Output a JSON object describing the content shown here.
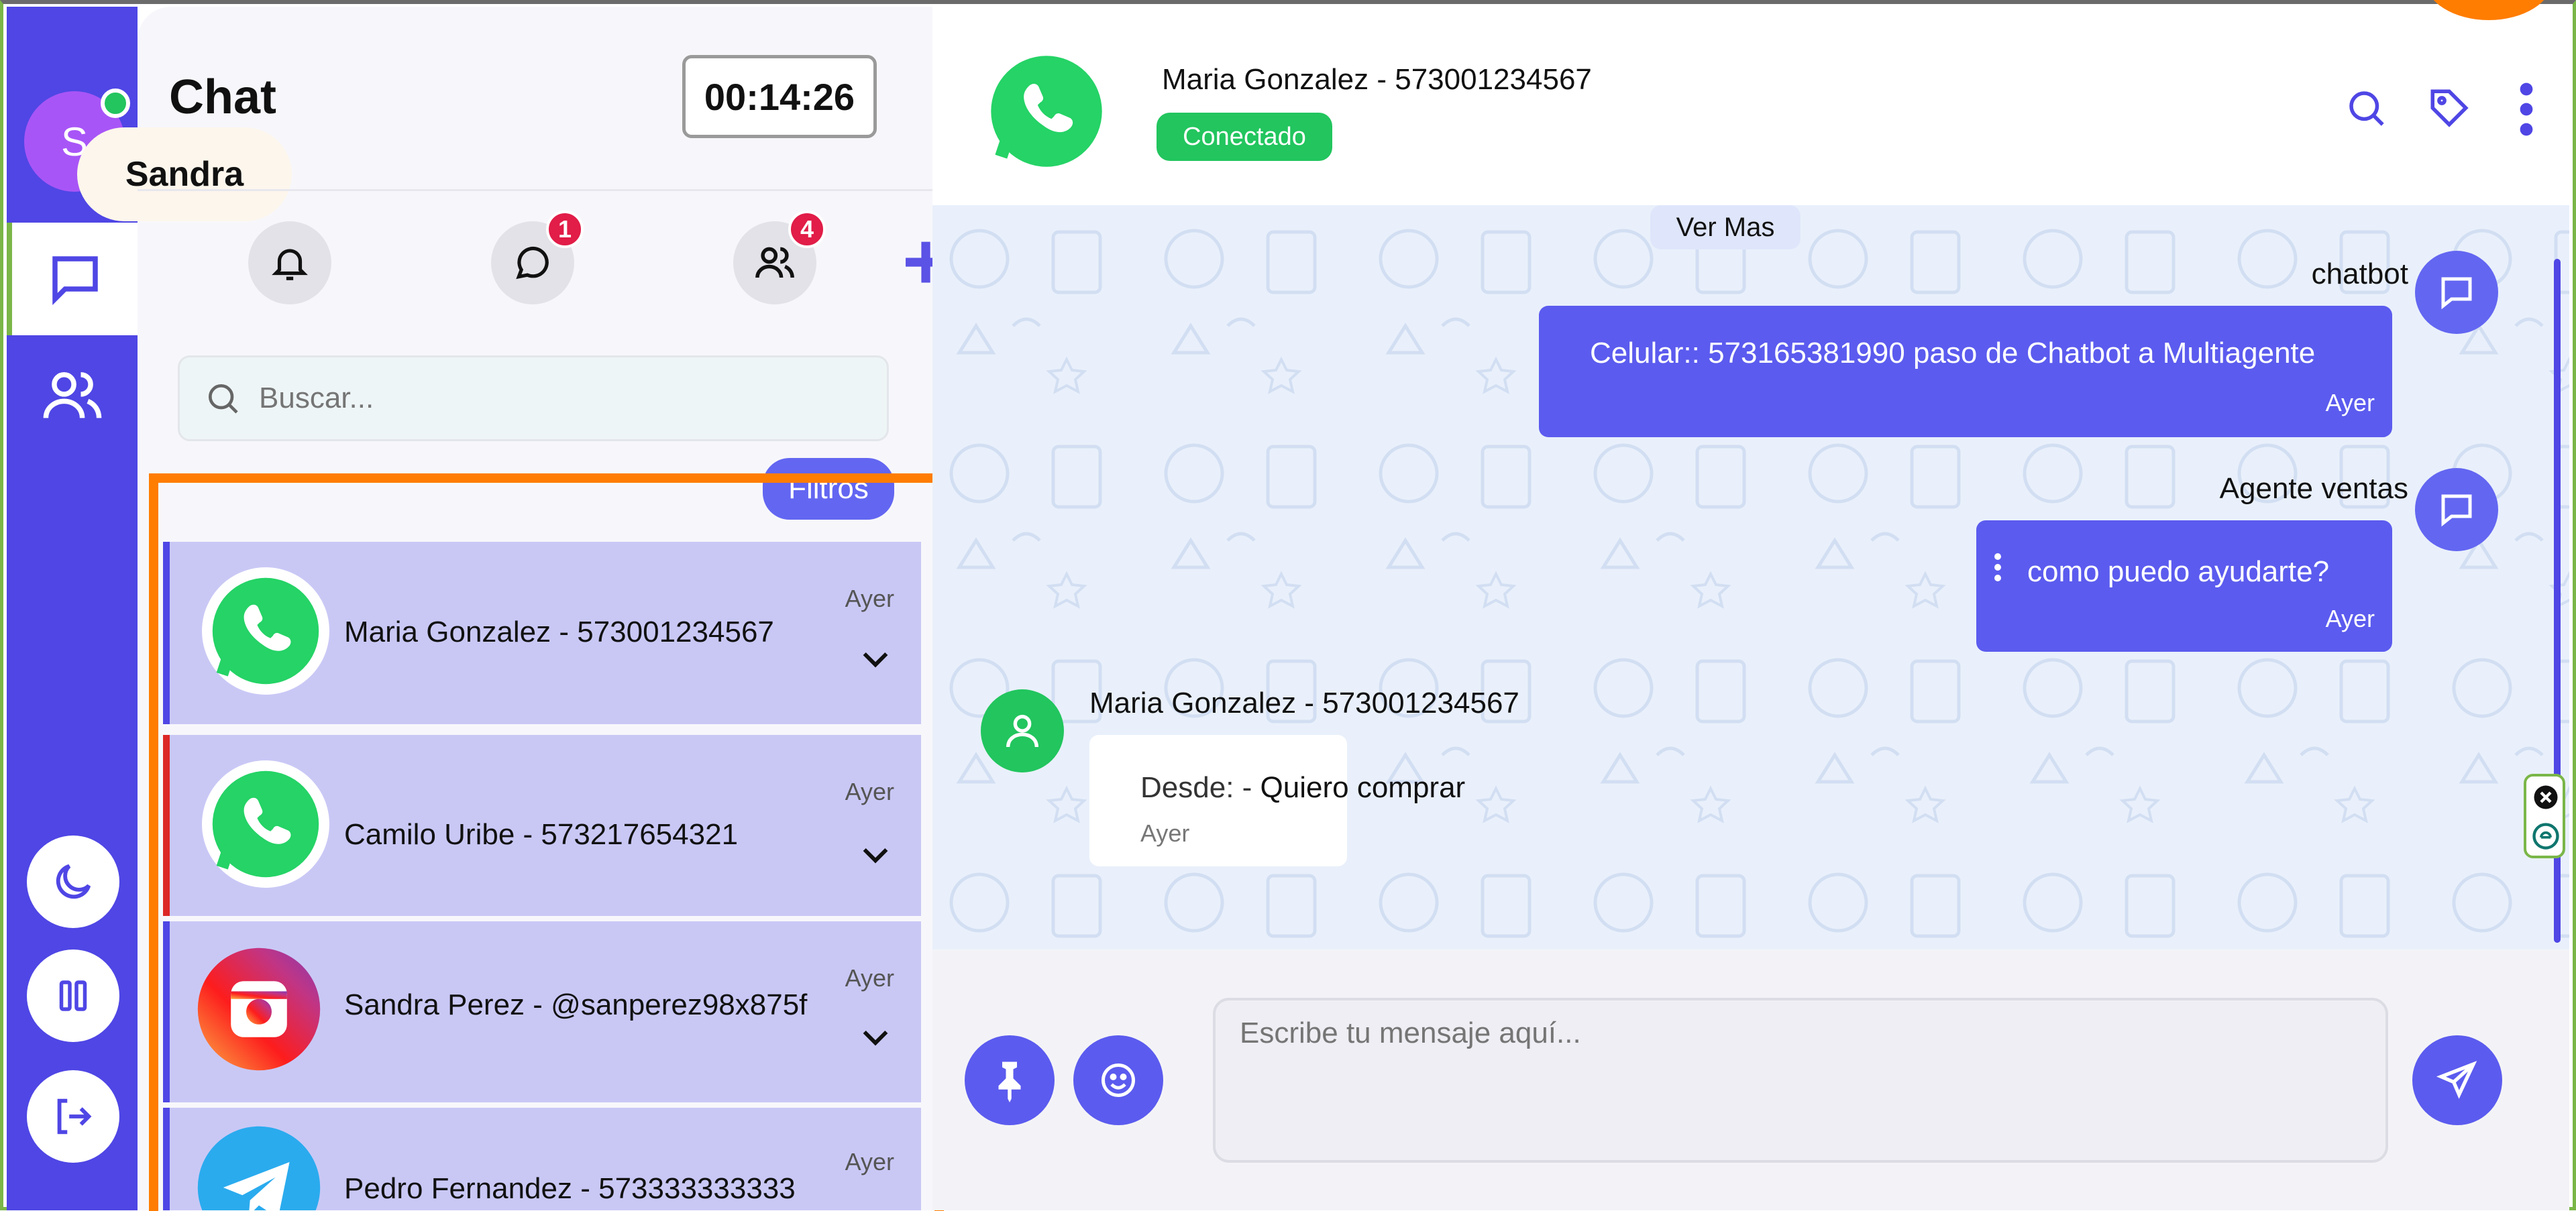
{
  "user": {
    "initial": "S",
    "name": "Sandra"
  },
  "list": {
    "title": "Chat",
    "timer": "00:14:26",
    "badges": {
      "chats": "1",
      "contacts": "4"
    },
    "plus": "+",
    "search_placeholder": "Buscar...",
    "filters_label": "Filtros",
    "items": [
      {
        "name": "Maria Gonzalez - 573001234567",
        "time": "Ayer",
        "channel": "whatsapp"
      },
      {
        "name": "Camilo Uribe - 573217654321",
        "time": "Ayer",
        "channel": "whatsapp"
      },
      {
        "name": "Sandra Perez - @sanperez98x875f",
        "time": "Ayer",
        "channel": "instagram"
      },
      {
        "name": "Pedro Fernandez - 573333333333",
        "time": "Ayer",
        "channel": "telegram"
      }
    ]
  },
  "conversation": {
    "contact": "Maria Gonzalez - 573001234567",
    "status": "Conectado",
    "see_more": "Ver Mas",
    "messages": [
      {
        "sender": "chatbot",
        "text": "Celular:: 573165381990 paso de Chatbot a Multiagente",
        "time": "Ayer"
      },
      {
        "sender": "Agente ventas",
        "text": "como puedo ayudarte?",
        "time": "Ayer"
      },
      {
        "sender": "Maria Gonzalez - 573001234567",
        "from_label": "Desde:",
        "dash": "-",
        "text": "Quiero comprar",
        "time": "Ayer"
      }
    ],
    "composer_placeholder": "Escribe tu mensaje aquí..."
  },
  "colors": {
    "accent": "#4f46e5",
    "highlight": "#ff7d00",
    "online": "#22c55e",
    "badge": "#e11d48"
  }
}
